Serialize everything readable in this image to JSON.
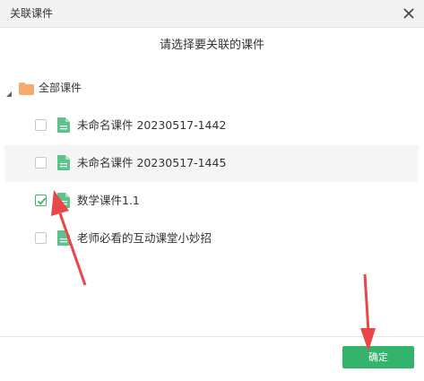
{
  "dialog": {
    "title": "关联课件",
    "subtitle": "请选择要关联的课件"
  },
  "tree": {
    "root_label": "全部课件",
    "items": [
      {
        "label": "未命名课件 20230517-1442",
        "checked": false
      },
      {
        "label": "未命名课件 20230517-1445",
        "checked": false
      },
      {
        "label": "数学课件1.1",
        "checked": true
      },
      {
        "label": "老师必看的互动课堂小妙招",
        "checked": false
      }
    ]
  },
  "footer": {
    "confirm_label": "确定"
  },
  "colors": {
    "accent": "#33b36b",
    "folder": "#f5a96a",
    "doc": "#5cc48a",
    "annotation_arrow": "#e8474a"
  }
}
